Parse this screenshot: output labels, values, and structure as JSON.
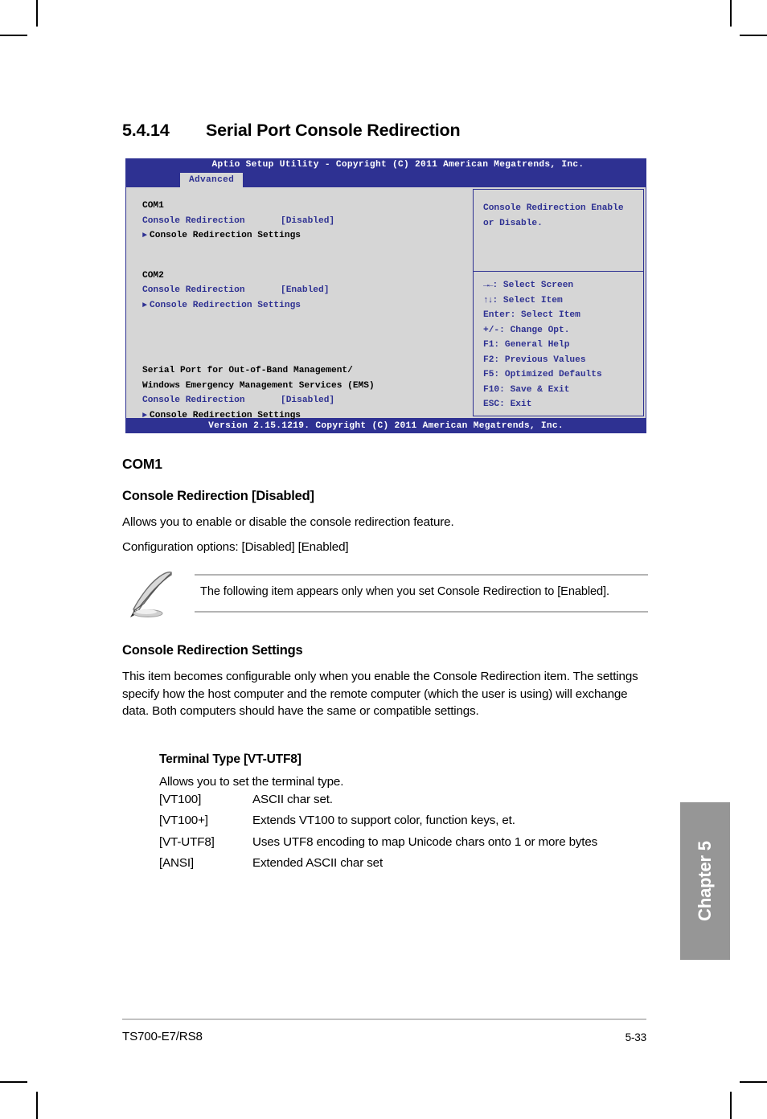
{
  "section": {
    "number": "5.4.14",
    "title": "Serial Port Console Redirection"
  },
  "bios": {
    "title_bar": "Aptio Setup Utility - Copyright (C) 2011 American Megatrends, Inc.",
    "active_tab": "Advanced",
    "groups": [
      {
        "header": "COM1",
        "setting_label": "Console Redirection",
        "setting_value": "[Disabled]",
        "submenu": "Console Redirection Settings"
      },
      {
        "header": "COM2",
        "setting_label": "Console Redirection",
        "setting_value": "[Enabled]",
        "submenu": "Console Redirection Settings"
      }
    ],
    "ems": {
      "header_line1": "Serial Port for Out-of-Band Management/",
      "header_line2": "Windows Emergency Management Services (EMS)",
      "setting_label": "Console Redirection",
      "setting_value": "[Disabled]",
      "submenu": "Console Redirection Settings"
    },
    "help": {
      "line1": "Console Redirection Enable",
      "line2": "or Disable."
    },
    "keys": [
      {
        "icon": "→←",
        "text": ": Select Screen"
      },
      {
        "icon": "↑↓",
        "text": ": Select Item"
      },
      {
        "icon": "",
        "text": "Enter: Select Item"
      },
      {
        "icon": "",
        "text": "+/-: Change Opt."
      },
      {
        "icon": "",
        "text": "F1: General Help"
      },
      {
        "icon": "",
        "text": "F2: Previous Values"
      },
      {
        "icon": "",
        "text": "F5: Optimized Defaults"
      },
      {
        "icon": "",
        "text": "F10: Save & Exit"
      },
      {
        "icon": "",
        "text": "ESC: Exit"
      }
    ],
    "footer_bar": "Version 2.15.1219. Copyright (C) 2011 American Megatrends, Inc.",
    "colors": {
      "bar_blue": "#2e3192",
      "panel_gray": "#d6d6d6"
    }
  },
  "content": {
    "com1_heading": "COM1",
    "console_redirection_heading": "Console Redirection [Disabled]",
    "console_redirection_desc": "Allows you to enable or disable the console redirection feature.",
    "console_redirection_options": "Configuration options: [Disabled] [Enabled]",
    "note": "The following item appears only when you set Console Redirection to [Enabled].",
    "settings_heading": "Console Redirection Settings",
    "settings_desc": "This item becomes configurable only when you enable the Console Redirection item. The settings specify how the host computer and the remote computer (which the user is using) will exchange data. Both computers should have the same or compatible settings.",
    "terminal": {
      "heading": "Terminal Type [VT-UTF8]",
      "desc": "Allows you to set the terminal type.",
      "options": [
        {
          "key": "[VT100]",
          "desc": "ASCII char set."
        },
        {
          "key": "[VT100+]",
          "desc": "Extends VT100 to support color, function keys, et."
        },
        {
          "key": "[VT-UTF8]",
          "desc": "Uses UTF8 encoding to map Unicode chars onto 1 or more bytes"
        },
        {
          "key": "[ANSI]",
          "desc": "Extended ASCII char set"
        }
      ]
    }
  },
  "chapter_tab": "Chapter 5",
  "footer": {
    "product": "TS700-E7/RS8",
    "page": "5-33"
  }
}
